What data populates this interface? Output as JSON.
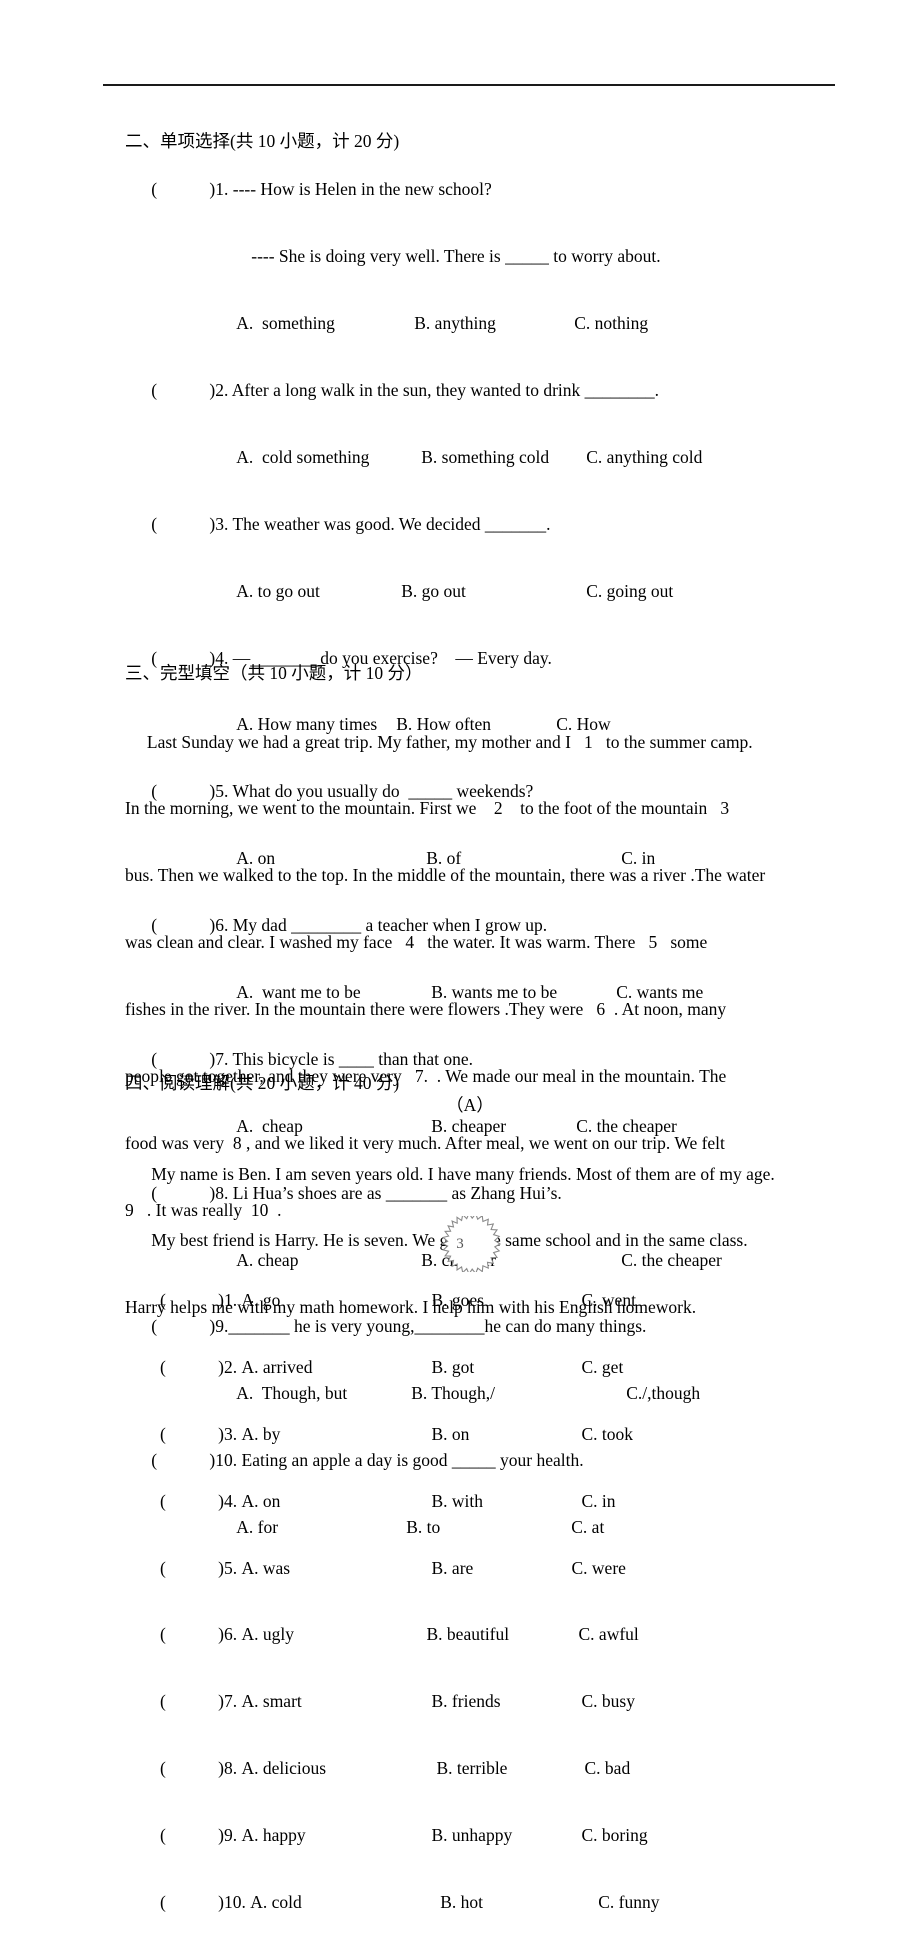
{
  "document": {
    "page_number": "3"
  },
  "section2": {
    "heading": "二、单项选择(共 10 小题，计 20 分)",
    "questions": [
      {
        "num": "1.",
        "stem_lines": [
          "---- How is Helen in the new school?",
          "---- She is doing very well. There is _____ to worry about."
        ],
        "options": [
          "A.  something",
          "B. anything",
          "C. nothing"
        ]
      },
      {
        "num": "2.",
        "stem_lines": [
          "After a long walk in the sun, they wanted to drink ________."
        ],
        "options": [
          "A.  cold something",
          "B. something cold",
          "C. anything cold"
        ]
      },
      {
        "num": "3.",
        "stem_lines": [
          "The weather was good. We decided _______."
        ],
        "options": [
          "A. to go out",
          "B. go out",
          "C. going out"
        ]
      },
      {
        "num": "4.",
        "stem_lines": [
          "—________do you exercise?    — Every day."
        ],
        "options": [
          "A. How many times",
          "B. How often",
          "C. How"
        ]
      },
      {
        "num": "5.",
        "stem_lines": [
          "What do you usually do  _____ weekends?"
        ],
        "options": [
          "A. on",
          "B. of",
          "C. in"
        ]
      },
      {
        "num": "6.",
        "stem_lines": [
          "My dad ________ a teacher when I grow up."
        ],
        "options": [
          "A.  want me to be",
          "B. wants me to be",
          "C. wants me"
        ]
      },
      {
        "num": "7.",
        "stem_lines": [
          "This bicycle is ____ than that one."
        ],
        "options": [
          "A.  cheap",
          "B. cheaper",
          "C. the cheaper"
        ]
      },
      {
        "num": "8.",
        "stem_lines": [
          "Li Hua’s shoes are as _______ as Zhang Hui’s."
        ],
        "options": [
          "A. cheap",
          "B. cheaper",
          "C. the cheaper"
        ]
      },
      {
        "num": "9.",
        "stem_lines": [
          "_______ he is very young,________he can do many things."
        ],
        "options": [
          "A.  Though, but",
          "B. Though,/",
          "C./,though"
        ]
      },
      {
        "num": "10.",
        "stem_lines": [
          "Eating an apple a day is good _____ your health."
        ],
        "options": [
          "A. for",
          "B. to",
          "C. at"
        ]
      }
    ]
  },
  "section3": {
    "heading": "三、完型填空（共 10 小题，计 10 分）",
    "passage_lines": [
      "     Last Sunday we had a great trip. My father, my mother and I   1   to the summer camp.",
      "In the morning, we went to the mountain. First we    2    to the foot of the mountain   3   ",
      "bus. Then we walked to the top. In the middle of the mountain, there was a river .The water",
      "was clean and clear. I washed my face   4   the water. It was warm. There   5   some",
      "fishes in the river. In the mountain there were flowers .They were   6  . At noon, many",
      "people got together, and they were very   7.  . We made our meal in the mountain. The",
      "food was very  8 , and we liked it very much. After meal, we went on our trip. We felt",
      "9   . It was really  10  ."
    ],
    "questions": [
      {
        "num": "1.",
        "options": [
          "A. go",
          "B. goes",
          "C. went"
        ]
      },
      {
        "num": "2.",
        "options": [
          "A. arrived",
          "B. got",
          "C. get"
        ]
      },
      {
        "num": "3.",
        "options": [
          "A. by",
          "B. on",
          "C. took"
        ]
      },
      {
        "num": "4.",
        "options": [
          "A. on",
          "B. with",
          "C. in"
        ]
      },
      {
        "num": "5.",
        "options": [
          "A. was",
          "B. are",
          "C. were"
        ]
      },
      {
        "num": "6.",
        "options": [
          "A. ugly",
          "B. beautiful",
          "C. awful"
        ]
      },
      {
        "num": "7.",
        "options": [
          "A. smart",
          "B. friends",
          "C. busy"
        ]
      },
      {
        "num": "8.",
        "options": [
          "A. delicious",
          "B. terrible",
          "C. bad"
        ]
      },
      {
        "num": "9.",
        "options": [
          "A. happy",
          "B. unhappy",
          "C. boring"
        ]
      },
      {
        "num": "10.",
        "options": [
          "A. cold",
          "B. hot",
          "C. funny"
        ]
      }
    ]
  },
  "section4": {
    "heading": "四、阅读理解(共 20 小题，计 40 分)",
    "passage_label": "（A）",
    "passage_lines": [
      "      My name is Ben. I am seven years old. I have many friends. Most of them are of my age.",
      "      My best friend is Harry. He is seven. We go to the same school and in the same class.",
      "Harry helps me with my math homework. I help him with his English homework."
    ]
  }
}
